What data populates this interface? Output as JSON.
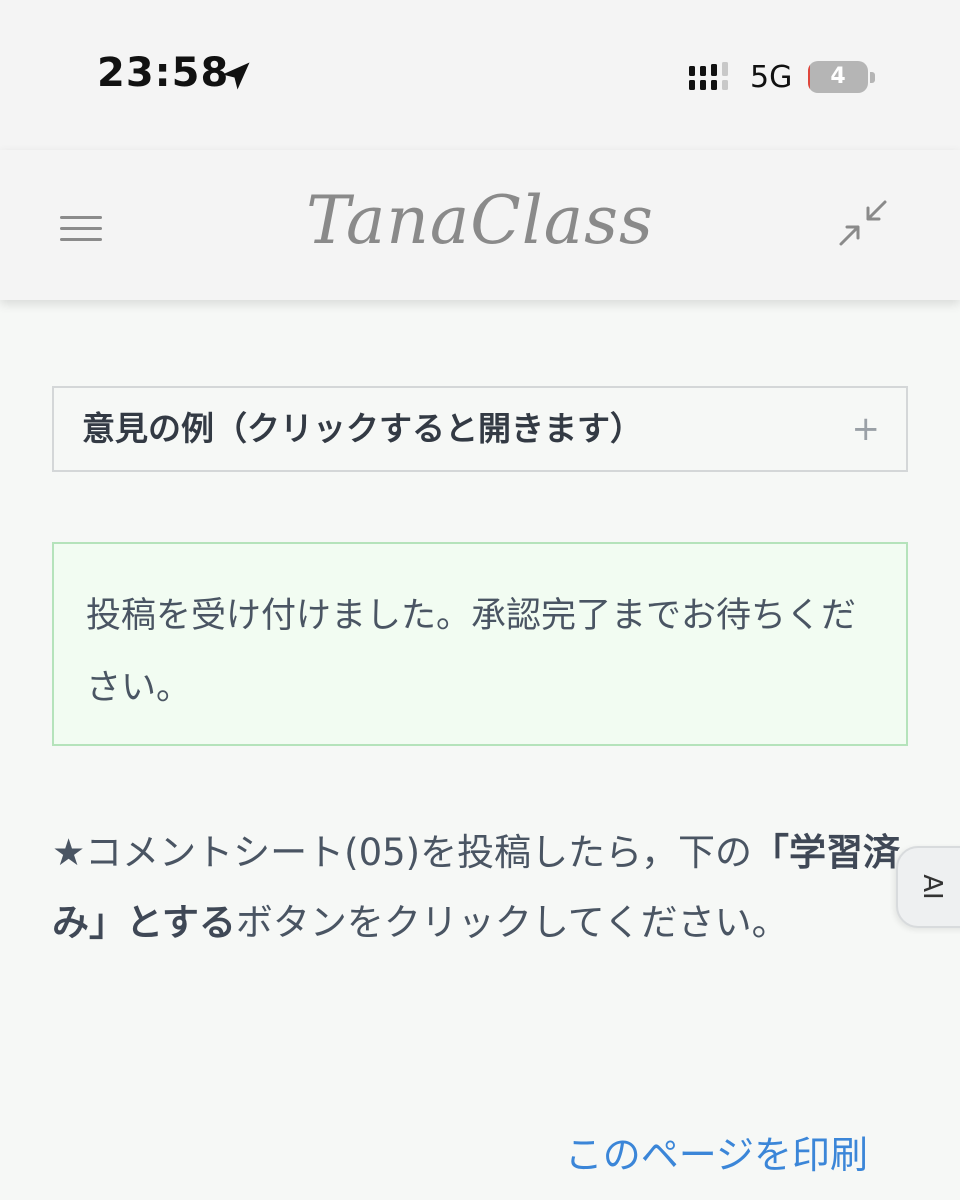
{
  "status_bar": {
    "time": "23:58",
    "network": "5G",
    "battery_level": "4",
    "battery_fraction": 0.04,
    "icons": [
      "location-arrow-icon",
      "signal-icon",
      "battery-icon"
    ]
  },
  "header": {
    "title": "TanaClass",
    "icons": [
      "hamburger-menu-icon",
      "collapse-icon"
    ]
  },
  "content": {
    "accordion": {
      "label": "意見の例（クリックすると開きます）",
      "toggle": "+"
    },
    "notice": {
      "text": "投稿を受け付けました。承認完了までお待ちください。"
    },
    "instruction": {
      "part1": "★コメントシート(05)を投稿したら，下の",
      "bold": "「学習済み」とする",
      "part2": "ボタンをクリックしてください。"
    },
    "print_link": "このページを印刷"
  },
  "side_tab": {
    "label": "AI"
  },
  "colors": {
    "background": "#f6f8f6",
    "header_bg": "#f4f4f4",
    "notice_border": "#b5e3bb",
    "notice_bg": "#f2fcf2",
    "link": "#3b86d8",
    "text": "#4a5563",
    "battery_low": "#e0463c"
  }
}
